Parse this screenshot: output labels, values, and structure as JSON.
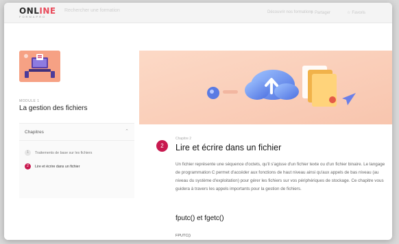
{
  "header": {
    "logo_main": "ONLINE",
    "logo_accent": "ONLINE",
    "logo_sub": "FORMAPRO",
    "search_placeholder": "Rechercher une formation",
    "links": [
      "Découvrir nos formations",
      "Partager",
      "Favoris"
    ]
  },
  "sidebar": {
    "module_label": "MODULE 1",
    "module_title": "La gestion des fichiers",
    "chapters_heading": "Chapitres",
    "items": [
      {
        "number": "1",
        "label": "Traitements de base sur les fichiers",
        "active": false
      },
      {
        "number": "2",
        "label": "Lire et écrire dans un fichier",
        "active": true
      }
    ]
  },
  "main": {
    "chapter_label": "Chapitre 2",
    "chapter_number": "2",
    "chapter_title": "Lire et écrire dans un fichier",
    "body": "Un fichier représente une séquence d'octets, qu'il s'agisse d'un fichier texte ou d'un fichier binaire. Le langage de programmation C permet d'accéder aux fonctions de haut niveau ainsi qu'aux appels de bas niveau (au niveau du système d'exploitation) pour gérer les fichiers sur vos périphériques de stockage. Ce chapitre vous guidera à travers les appels importants pour la gestion de fichiers.",
    "section_title": "fputc() et fgetc()",
    "code_label": "FPUTC()"
  },
  "colors": {
    "accent": "#c8194f",
    "banner": "#fbd2bd"
  },
  "icons": [
    "share-icon",
    "star-icon",
    "chevron-up-icon",
    "cloud-upload-icon",
    "paper-plane-icon"
  ]
}
